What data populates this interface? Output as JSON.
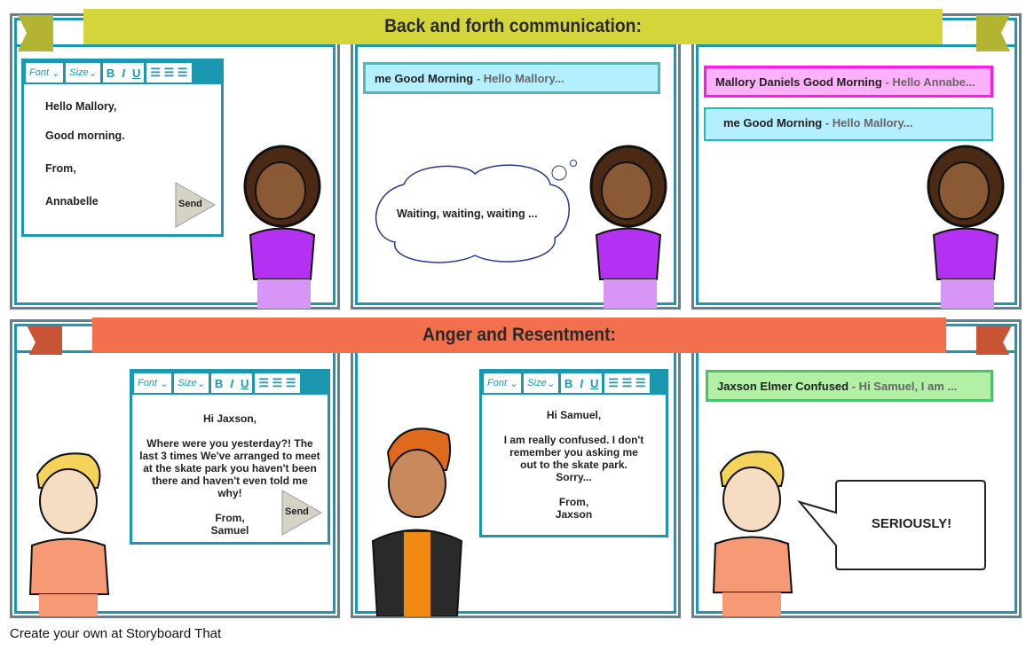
{
  "banners": [
    {
      "title": "Back and forth communication:",
      "color": "#d4d53a"
    },
    {
      "title": "Anger and Resentment:",
      "color": "#f2704e"
    }
  ],
  "toolbar": {
    "font": "Font",
    "size": "Size",
    "bold": "B",
    "italic": "I",
    "underline": "U"
  },
  "send_label": "Send",
  "panel1": {
    "lines": [
      "Hello Mallory,",
      "Good morning.",
      "From,",
      "Annabelle"
    ]
  },
  "panel2": {
    "message": {
      "subject": "me Good Morning",
      "preview": "- Hello Mallory..."
    },
    "thought": "Waiting, waiting, waiting ..."
  },
  "panel3": {
    "messages": [
      {
        "subject": "Mallory Daniels Good Morning",
        "preview": "- Hello Annabe...",
        "color": "#ffb0fb",
        "border": "#ff19e6"
      },
      {
        "subject": "me Good Morning",
        "preview": "- Hello Mallory...",
        "color": "#b3efff",
        "border": "#22b9b9"
      }
    ]
  },
  "panel4": {
    "lines": [
      "Hi Jaxson,",
      "Where were you yesterday?! The last 3 times We've arranged to meet at the skate park you haven't been there and haven't even told me why!",
      "From,",
      "Samuel"
    ]
  },
  "panel5": {
    "lines": [
      "Hi Samuel,",
      "I am really confused. I don't remember you asking me out to the skate park. Sorry...",
      "From,",
      "Jaxson"
    ]
  },
  "panel6": {
    "message": {
      "subject": "Jaxson Elmer Confused",
      "preview": "- Hi Samuel, I am ...",
      "color": "#b2f0a6",
      "border": "#4fc069"
    },
    "speech": "SERIOUSLY!"
  },
  "footer": "Create your own at Storyboard That"
}
